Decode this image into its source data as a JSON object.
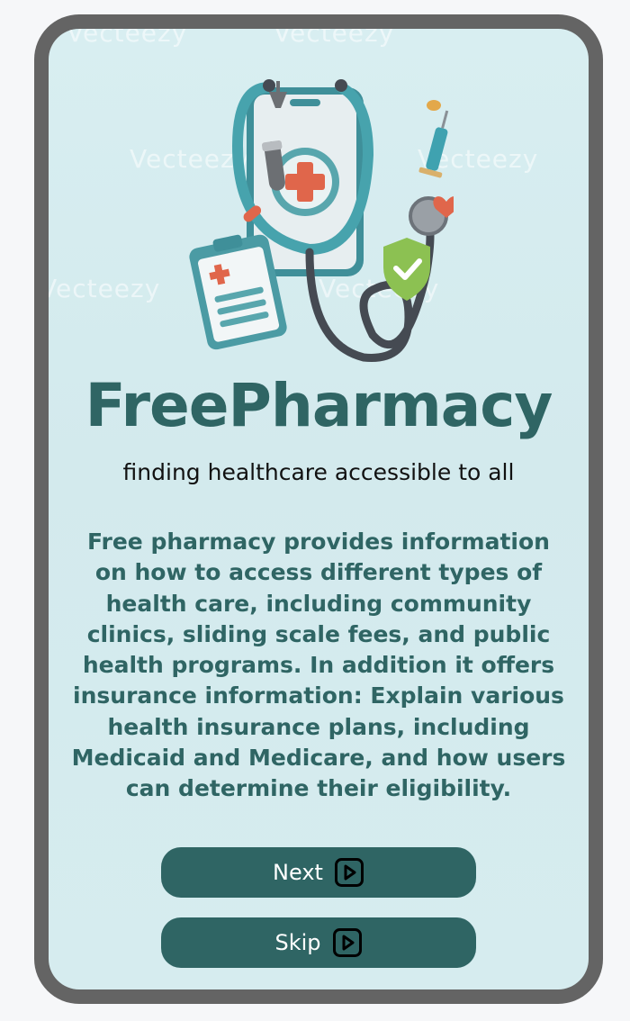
{
  "app": {
    "title": "FreePharmacy",
    "tagline": "finding healthcare accessible to all"
  },
  "description": "Free pharmacy provides information on how to access different types of health care, including community clinics, sliding scale fees, and public health programs. In addition it offers insurance information: Explain various health insurance plans, including Medicaid and Medicare, and how users can determine their eligibility.",
  "buttons": {
    "next": {
      "label": "Next",
      "icon": "play-square-icon"
    },
    "skip": {
      "label": "Skip",
      "icon": "play-square-icon"
    }
  },
  "watermark": "Vecteezy",
  "colors": {
    "brand": "#2f6564",
    "frame": "#646464",
    "screen_bg": "#d6ecef",
    "button_text": "#ffffff"
  },
  "illustration": {
    "icons": [
      "stethoscope-icon",
      "smartphone-icon",
      "medical-cross-icon",
      "clipboard-icon",
      "shield-check-icon",
      "syringe-icon",
      "pill-icon",
      "heart-icon",
      "test-tube-icon"
    ]
  }
}
